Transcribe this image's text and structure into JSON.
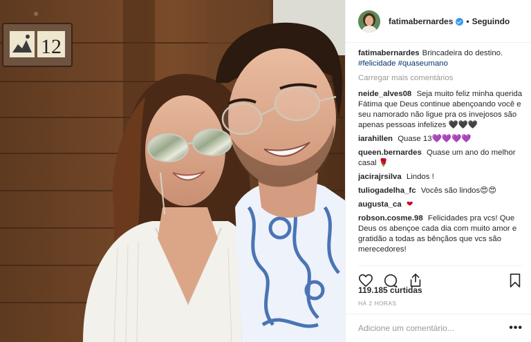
{
  "header": {
    "username": "fatimabernardes",
    "separator": "•",
    "follow_label": "Seguindo",
    "avatar_icon": "profile-avatar",
    "verified_icon": "verified-badge-icon"
  },
  "caption": {
    "username": "fatimabernardes",
    "text": "Brincadeira do destino.",
    "hashtag_1": "#felicidade",
    "hashtag_2": "#quaseumano"
  },
  "load_more": "Carregar mais comentários",
  "comments": [
    {
      "user": "neide_alves08",
      "text": "Seja muito feliz minha querida Fátima que Deus continue abençoando você e seu namorado não ligue pra os invejosos são apenas pessoas infelizes 🖤🖤🖤"
    },
    {
      "user": "iarahillen",
      "text": "Quase 13💜💜💜💜"
    },
    {
      "user": "queen.bernardes",
      "text": "Quase um ano do melhor casal 🌹"
    },
    {
      "user": "jacirajrsilva",
      "text": "Lindos !"
    },
    {
      "user": "tuliogadelha_fc",
      "text": "Vocês são lindos😍😍"
    },
    {
      "user": "augusta_ca",
      "text": "❤"
    },
    {
      "user": "robson.cosme.98",
      "text": "Felicidades pra vcs! Que Deus os abençoe cada dia com muito amor e gratidão a todas as bênçãos que vcs são merecedores!"
    }
  ],
  "actions": {
    "like_icon": "heart-icon",
    "comment_icon": "comment-icon",
    "share_icon": "share-icon",
    "save_icon": "bookmark-icon"
  },
  "likes": "119.185 curtidas",
  "timestamp": "HÁ 2 HORAS",
  "add_comment": {
    "placeholder": "Adicione um comentário...",
    "more_label": "•••"
  },
  "photo": {
    "room_number": "12",
    "description_icon": "photo-couple-selfie"
  },
  "colors": {
    "link": "#003569",
    "muted": "#999999",
    "verified": "#3897f0",
    "text": "#262626",
    "heart_emoji": "#c4001f",
    "purple_heart": "#9b2de0"
  }
}
